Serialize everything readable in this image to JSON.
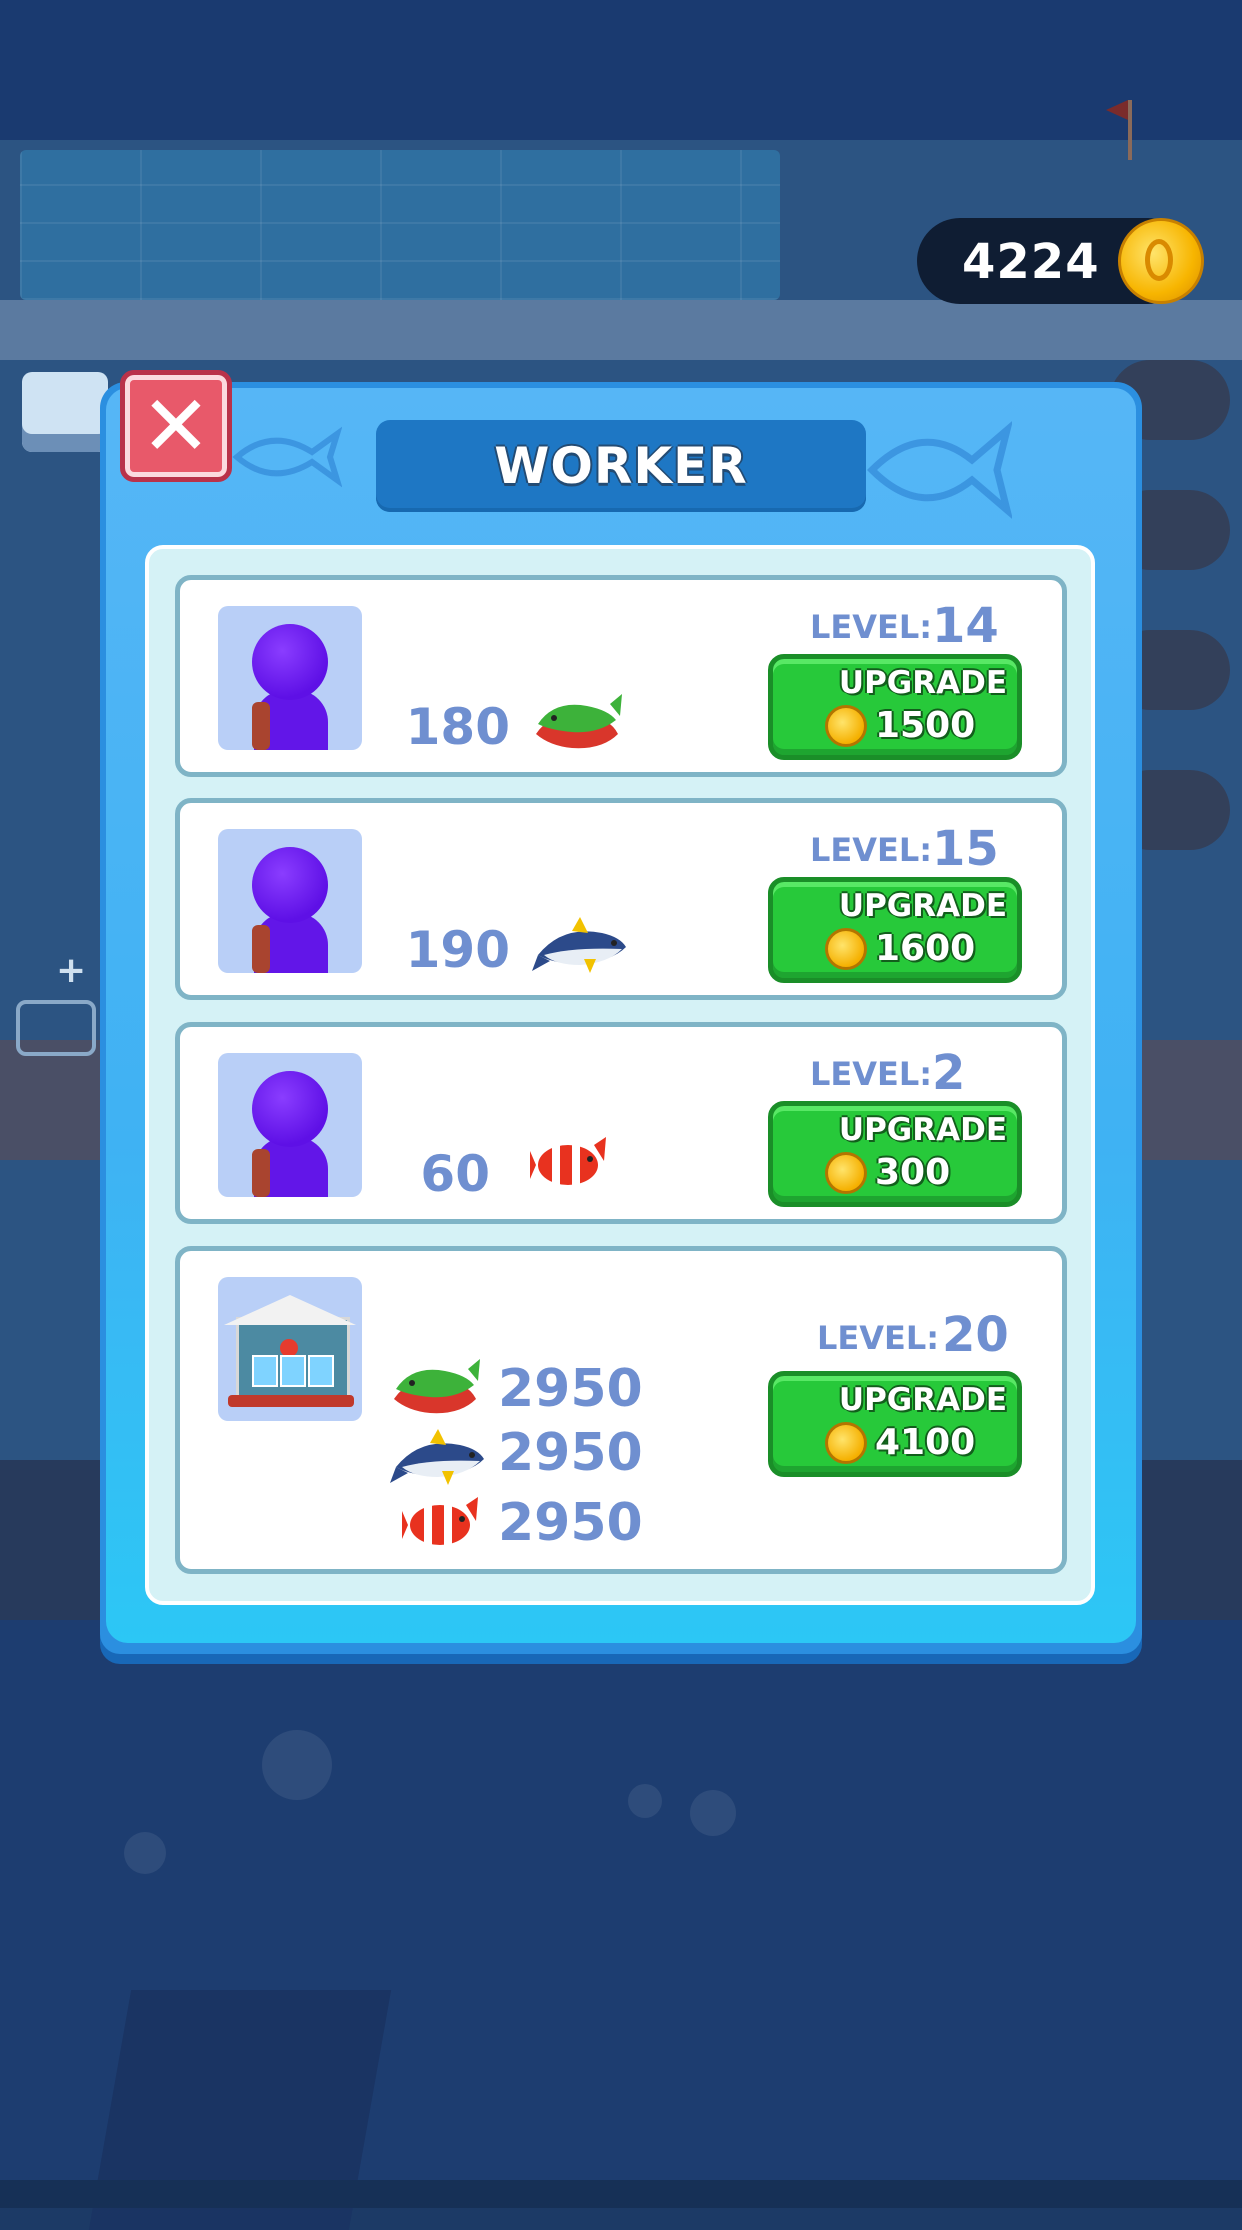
{
  "hud": {
    "coins": "4224"
  },
  "panel": {
    "title": "WORKER"
  },
  "colors": {
    "panel_blue": "#2b8fe0",
    "button_green": "#27c93a",
    "close_red": "#e8596a",
    "label_blue": "#6f8fd0"
  },
  "workers": [
    {
      "avatar": "worker-avatar-icon",
      "count": "180",
      "fish": "green-fish-icon",
      "level_label": "LEVEL:",
      "level": "14",
      "upgrade_label": "UPGRADE",
      "upgrade_cost": "1500"
    },
    {
      "avatar": "worker-avatar-icon",
      "count": "190",
      "fish": "tuna-fish-icon",
      "level_label": "LEVEL:",
      "level": "15",
      "upgrade_label": "UPGRADE",
      "upgrade_cost": "1600"
    },
    {
      "avatar": "worker-avatar-icon",
      "count": "60",
      "fish": "clownfish-icon",
      "level_label": "LEVEL:",
      "level": "2",
      "upgrade_label": "UPGRADE",
      "upgrade_cost": "300"
    }
  ],
  "house": {
    "avatar": "house-icon",
    "counts": [
      {
        "fish": "green-fish-icon",
        "value": "2950"
      },
      {
        "fish": "tuna-fish-icon",
        "value": "2950"
      },
      {
        "fish": "clownfish-icon",
        "value": "2950"
      }
    ],
    "level_label": "LEVEL:",
    "level": "20",
    "upgrade_label": "UPGRADE",
    "upgrade_cost": "4100"
  }
}
